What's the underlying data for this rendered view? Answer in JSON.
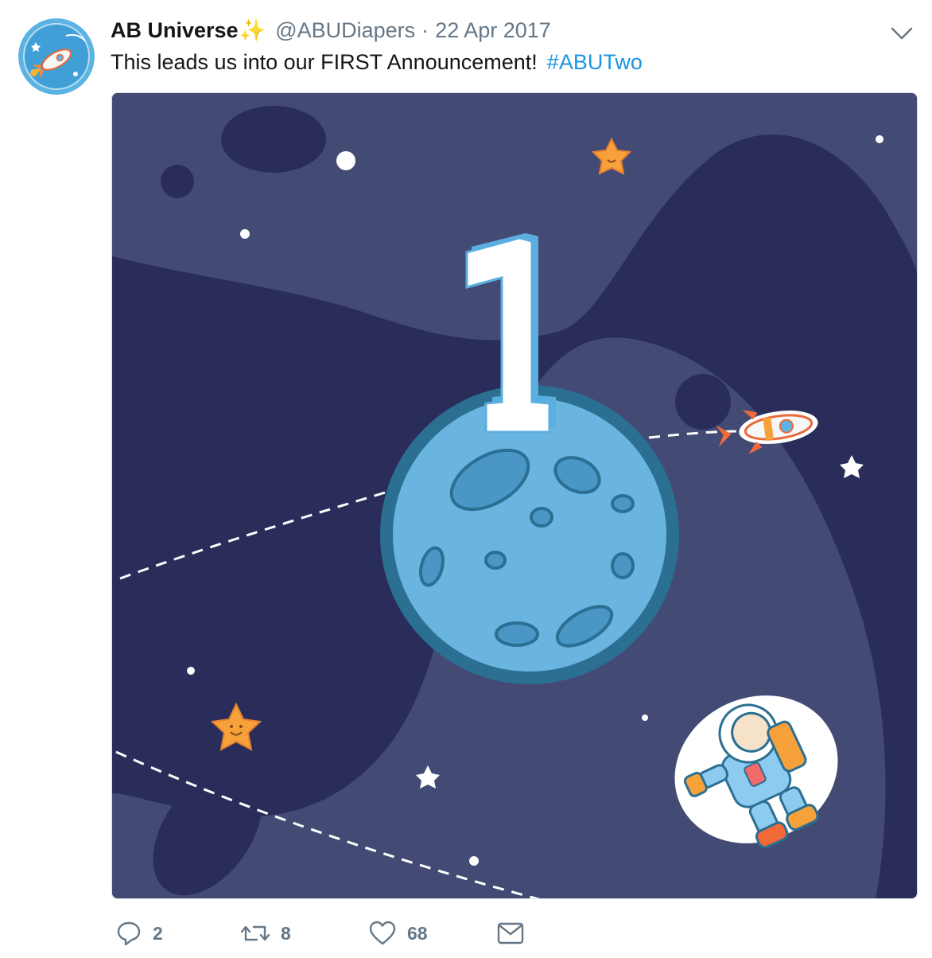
{
  "tweet": {
    "display_name": "AB Universe",
    "name_emoji": "✨",
    "handle": "@ABUDiapers",
    "separator": "·",
    "date": "22 Apr 2017",
    "text": "This leads us into our FIRST Announcement!",
    "hashtag": "#ABUTwo"
  },
  "media": {
    "number": "1"
  },
  "actions": {
    "reply_count": "2",
    "retweet_count": "8",
    "like_count": "68"
  },
  "icons": {
    "menu": "chevron-down-icon",
    "reply": "reply-icon",
    "retweet": "retweet-icon",
    "like": "heart-icon",
    "dm": "envelope-icon"
  },
  "colors": {
    "link": "#1b95e0",
    "muted": "#657786",
    "space_light": "#434b75",
    "space_dark": "#2a2d5a",
    "moon": "#6ab4e0"
  }
}
